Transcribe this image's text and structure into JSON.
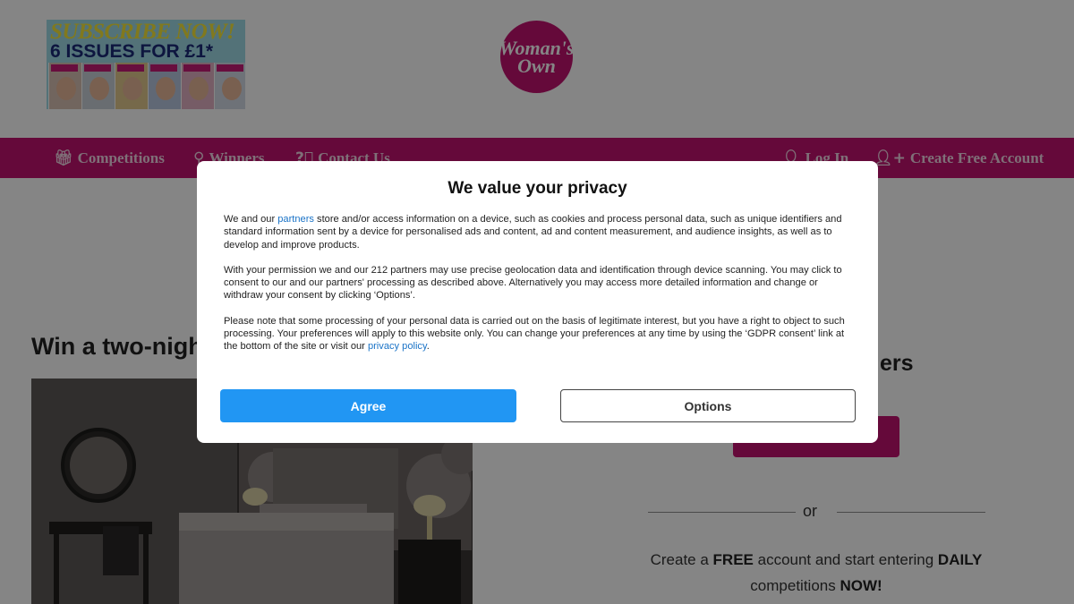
{
  "promo": {
    "line1": "SUBSCRIBE NOW!",
    "line2": "6 ISSUES FOR £1*"
  },
  "logo": {
    "line1": "Woman's",
    "line2": "Own",
    "color": "#c2126f"
  },
  "nav": {
    "left": [
      {
        "label": "Competitions",
        "icon": "gift-icon"
      },
      {
        "label": "Winners",
        "icon": "map-pin-icon"
      },
      {
        "label": "Contact Us",
        "icon": "question-circle-icon"
      }
    ],
    "right": [
      {
        "label": "Log In",
        "icon": "user-icon"
      },
      {
        "label": "Create Free Account",
        "icon": "user-plus-icon"
      }
    ]
  },
  "page": {
    "headline_partial": "Win a two-nigh",
    "headline_right_partial": "ers",
    "or": "or",
    "cta": {
      "t1": "Create a ",
      "b1": "FREE",
      "t2": " account and start entering ",
      "b2": "DAILY",
      "t3": "competitions ",
      "b3": "NOW!"
    }
  },
  "privacy": {
    "title": "We value your privacy",
    "p1_before": "We and our ",
    "p1_link": "partners",
    "p1_after": " store and/or access information on a device, such as cookies and process personal data, such as unique identifiers and standard information sent by a device for personalised ads and content, ad and content measurement, and audience insights, as well as to develop and improve products.",
    "p2": "With your permission we and our 212 partners may use precise geolocation data and identification through device scanning. You may click to consent to our and our partners' processing as described above. Alternatively you may access more detailed information and change or withdraw your consent by clicking ‘Options’.",
    "p3_before": "Please note that some processing of your personal data is carried out on the basis of legitimate interest, but you have a right to object to such processing. Your preferences will apply to this website only. You can change your preferences at any time by using the ‘GDPR consent’ link at the bottom of the site or visit our ",
    "p3_link": "privacy policy",
    "p3_after": ".",
    "agree_label": "Agree",
    "options_label": "Options"
  },
  "colors": {
    "brand": "#c2126f",
    "agree": "#2196f3",
    "link": "#1a73c7"
  }
}
